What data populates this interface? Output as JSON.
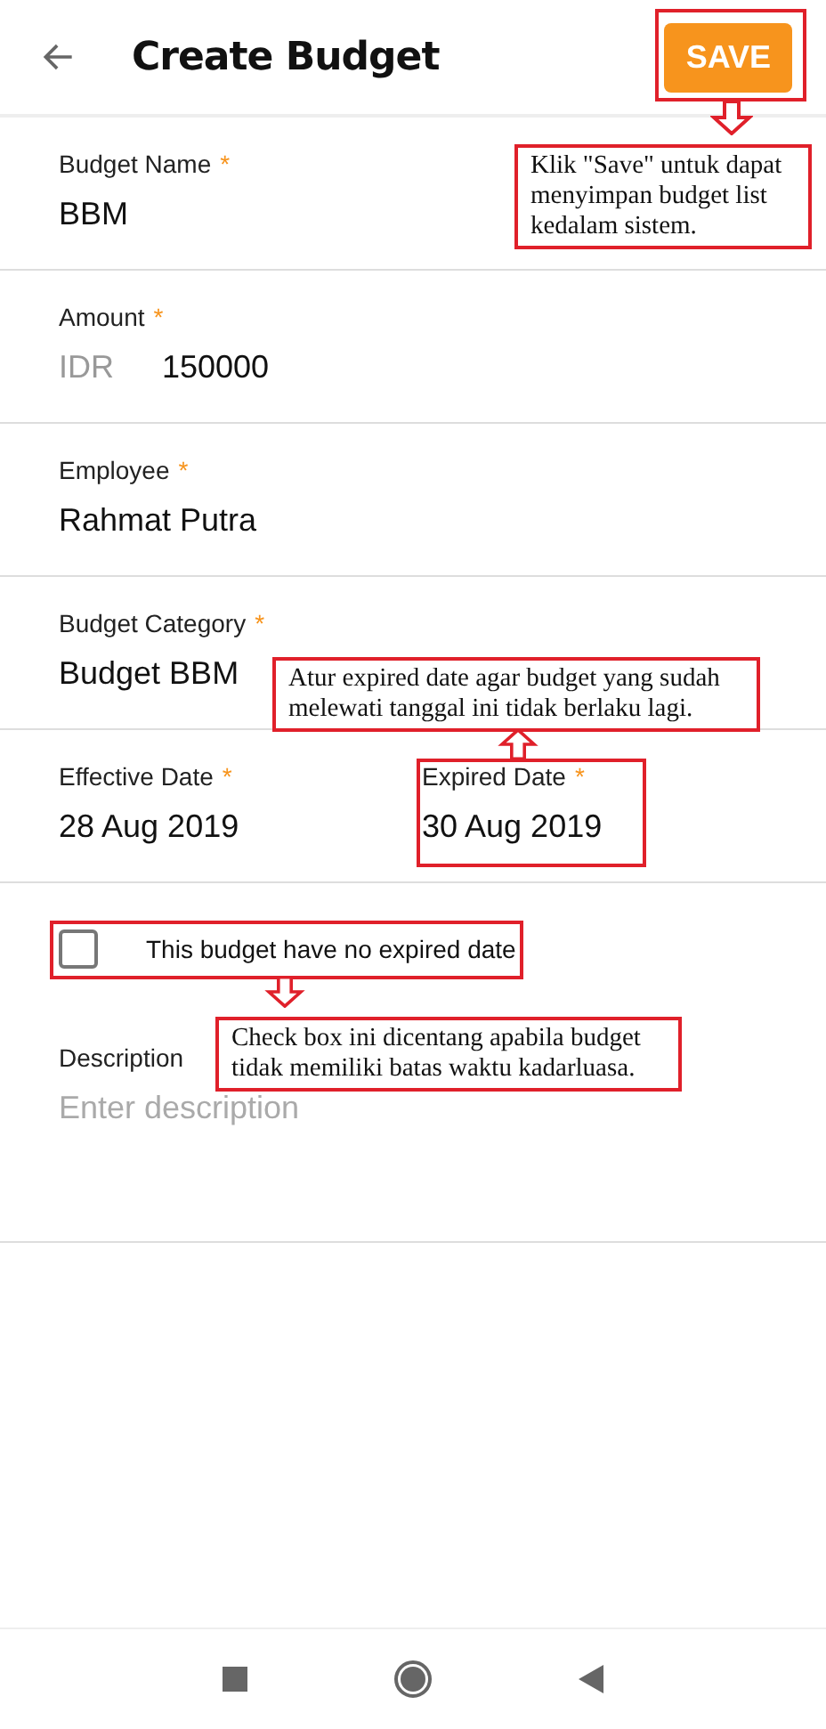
{
  "header": {
    "title": "Create Budget",
    "save_label": "SAVE"
  },
  "fields": [
    {
      "label": "Budget Name",
      "mark": "*",
      "value": "BBM"
    },
    {
      "label": "Amount",
      "mark": "*",
      "prefix": "IDR",
      "value": "150000"
    },
    {
      "label": "Employee",
      "mark": "*",
      "value": "Rahmat Putra"
    },
    {
      "label": "Budget Category",
      "mark": "*",
      "value": "Budget BBM"
    }
  ],
  "dates": [
    {
      "label": "Effective Date",
      "mark": "*",
      "value": "28 Aug 2019"
    },
    {
      "label": "Expired Date",
      "mark": "*",
      "value": "30 Aug 2019"
    }
  ],
  "no_expiry": {
    "label": "This budget have no expired date",
    "checked": false
  },
  "description": {
    "label": "Description",
    "placeholder": "Enter description"
  },
  "annotations": [
    {
      "text": "Klik \"Save\" untuk dapat menyimpan budget list kedalam sistem."
    },
    {
      "text": "Atur expired date agar budget yang sudah melewati tanggal ini tidak berlaku lagi."
    },
    {
      "text": "Check box ini dicentang apabila budget tidak memiliki batas waktu kadarluasa."
    }
  ]
}
